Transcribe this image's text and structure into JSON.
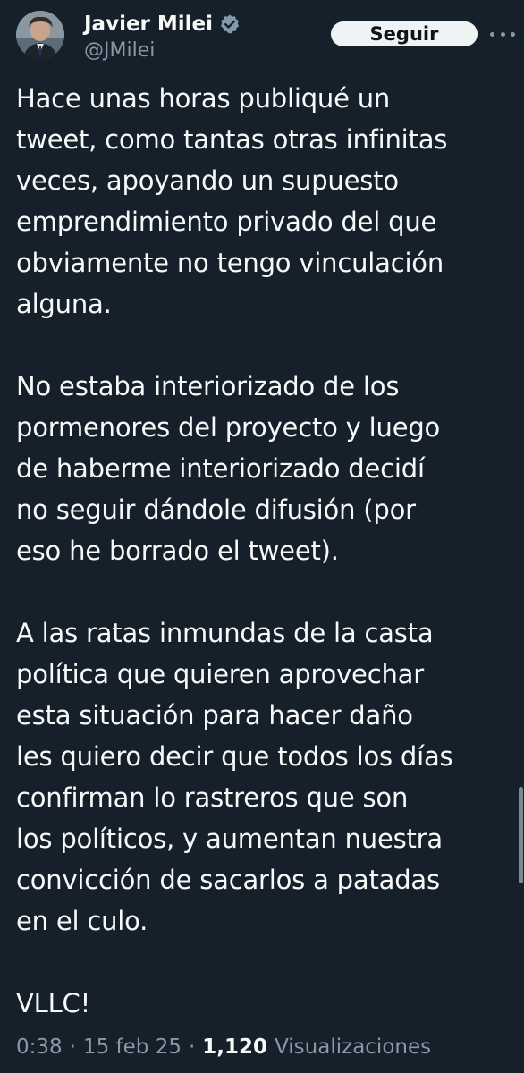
{
  "author": {
    "display_name": "Javier Milei",
    "handle": "@JMilei",
    "verified_icon": "verified-badge-icon",
    "avatar_icon": "avatar"
  },
  "actions": {
    "follow_label": "Seguir",
    "more_icon": "more-options-icon"
  },
  "tweet": {
    "paragraphs": [
      "Hace unas horas publiqué un\ntweet, como tantas otras infinitas\nveces, apoyando un supuesto\nemprendimiento privado del que\nobviamente no tengo vinculación\nalguna.",
      "No estaba interiorizado de los\npormenores del proyecto y luego\nde haberme interiorizado decidí\nno seguir dándole difusión (por\neso he borrado el tweet).",
      "A las ratas inmundas de la casta\npolítica que quieren aprovechar\nesta situación para hacer daño\nles quiero decir que todos los días\nconfirman lo rastreros que son\nlos políticos, y aumentan nuestra\nconvicción de sacarlos a patadas\nen el culo.",
      "VLLC!"
    ]
  },
  "meta": {
    "time": "0:38",
    "separator": "·",
    "date": "15 feb 25",
    "views_count": "1,120",
    "views_label": "Visualizaciones"
  },
  "colors": {
    "background": "#15202b",
    "text": "#f7f9f9",
    "secondary_text": "#8b98a5",
    "verified": "#829aab",
    "button_bg": "#eff3f4"
  }
}
